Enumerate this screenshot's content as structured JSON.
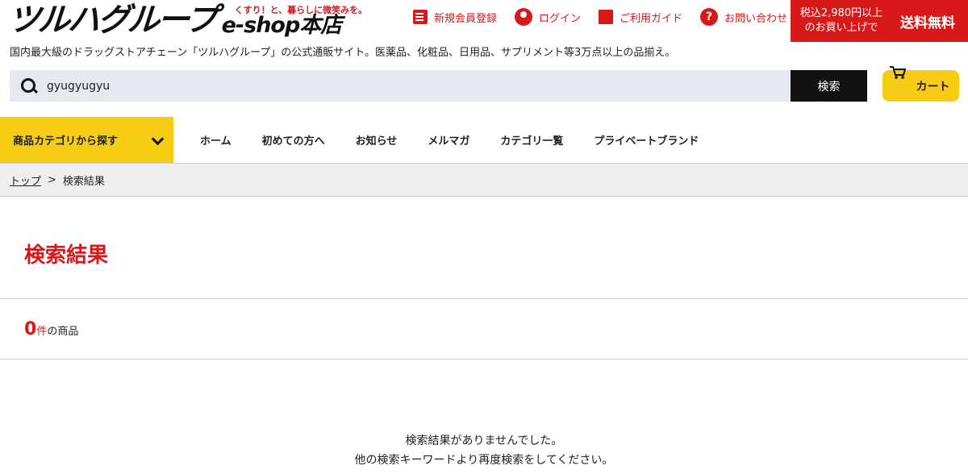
{
  "header": {
    "logo_text": "ツルハグループ",
    "logo_tagline": "くすり！と、暮らしに微笑みを。",
    "logo_shop": "e-shop本店",
    "nav": [
      {
        "label": "新規会員登録",
        "icon": "register-icon"
      },
      {
        "label": "ログイン",
        "icon": "login-icon"
      },
      {
        "label": "ご利用ガイド",
        "icon": "guide-icon"
      },
      {
        "label": "お問い合わせ",
        "icon": "help-icon"
      }
    ],
    "free_shipping_condition_line1": "税込2,980円以上",
    "free_shipping_condition_line2": "のお買い上げで",
    "free_shipping_label": "送料無料",
    "tagline": "国内最大級のドラッグストアチェーン「ツルハグループ」の公式通販サイト。医薬品、化粧品、日用品、サプリメント等3万点以上の品揃え。"
  },
  "search": {
    "value": "gyugyugyu",
    "button_label": "検索",
    "cart_label": "カート"
  },
  "menu": {
    "category_button": "商品カテゴリから探す",
    "items": [
      "ホーム",
      "初めての方へ",
      "お知らせ",
      "メルマガ",
      "カテゴリ一覧",
      "プライベートブランド"
    ]
  },
  "breadcrumb": {
    "top": "トップ",
    "separator": ">",
    "current": "検索結果"
  },
  "main": {
    "title": "検索結果",
    "count": "0",
    "count_unit": "件",
    "count_suffix": "の商品",
    "no_result_line1": "検索結果がありませんでした。",
    "no_result_line2": "他の検索キーワードより再度検索をしてください。"
  },
  "colors": {
    "brand_red": "#d7191a",
    "accent_yellow": "#f6cc14"
  }
}
